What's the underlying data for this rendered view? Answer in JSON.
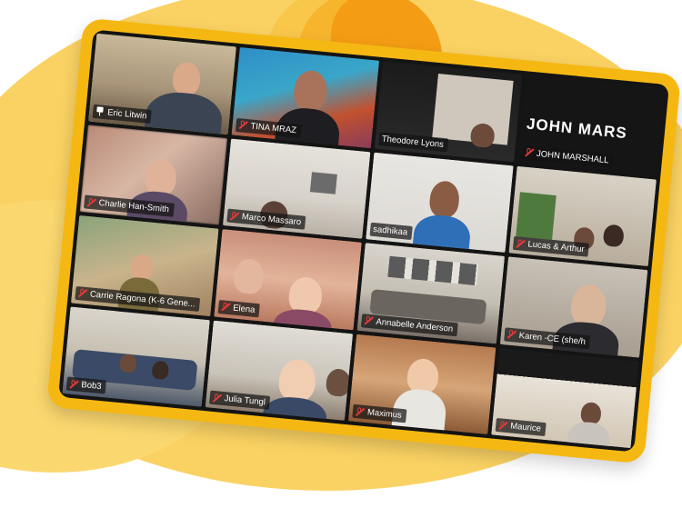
{
  "app": {
    "name": "Video conference gallery view"
  },
  "tiles": [
    {
      "name": "Eric Litwin",
      "indicator": "pin-icon",
      "active": true
    },
    {
      "name": "TINA MRAZ",
      "indicator": "mic-muted-icon"
    },
    {
      "name": "Theodore Lyons",
      "indicator": "none"
    },
    {
      "name": "JOHN MARSHALL",
      "indicator": "mic-muted-icon",
      "big_name": "JOHN MARS"
    },
    {
      "name": "Charlie Han-Smith",
      "indicator": "mic-muted-icon"
    },
    {
      "name": "Marco Massaro",
      "indicator": "mic-muted-icon"
    },
    {
      "name": "sadhikaa",
      "indicator": "none"
    },
    {
      "name": "Lucas & Arthur",
      "indicator": "mic-muted-icon"
    },
    {
      "name": "Carrie Ragona (K-6 Gene...",
      "indicator": "mic-muted-icon"
    },
    {
      "name": "Elena",
      "indicator": "mic-muted-icon"
    },
    {
      "name": "Annabelle Anderson",
      "indicator": "mic-muted-icon"
    },
    {
      "name": "Karen -CE  (she/h",
      "indicator": "mic-muted-icon"
    },
    {
      "name": "Bob3",
      "indicator": "mic-muted-icon"
    },
    {
      "name": "Julia Tungl",
      "indicator": "mic-muted-icon"
    },
    {
      "name": "Maximus",
      "indicator": "mic-muted-icon"
    },
    {
      "name": "Maurice",
      "indicator": "mic-muted-icon"
    }
  ],
  "colors": {
    "frame": "#f5b813",
    "screen_bg": "#141414",
    "active_speaker_border": "#c9e35a",
    "muted_icon": "#e23a3a",
    "background": "#fad263"
  }
}
